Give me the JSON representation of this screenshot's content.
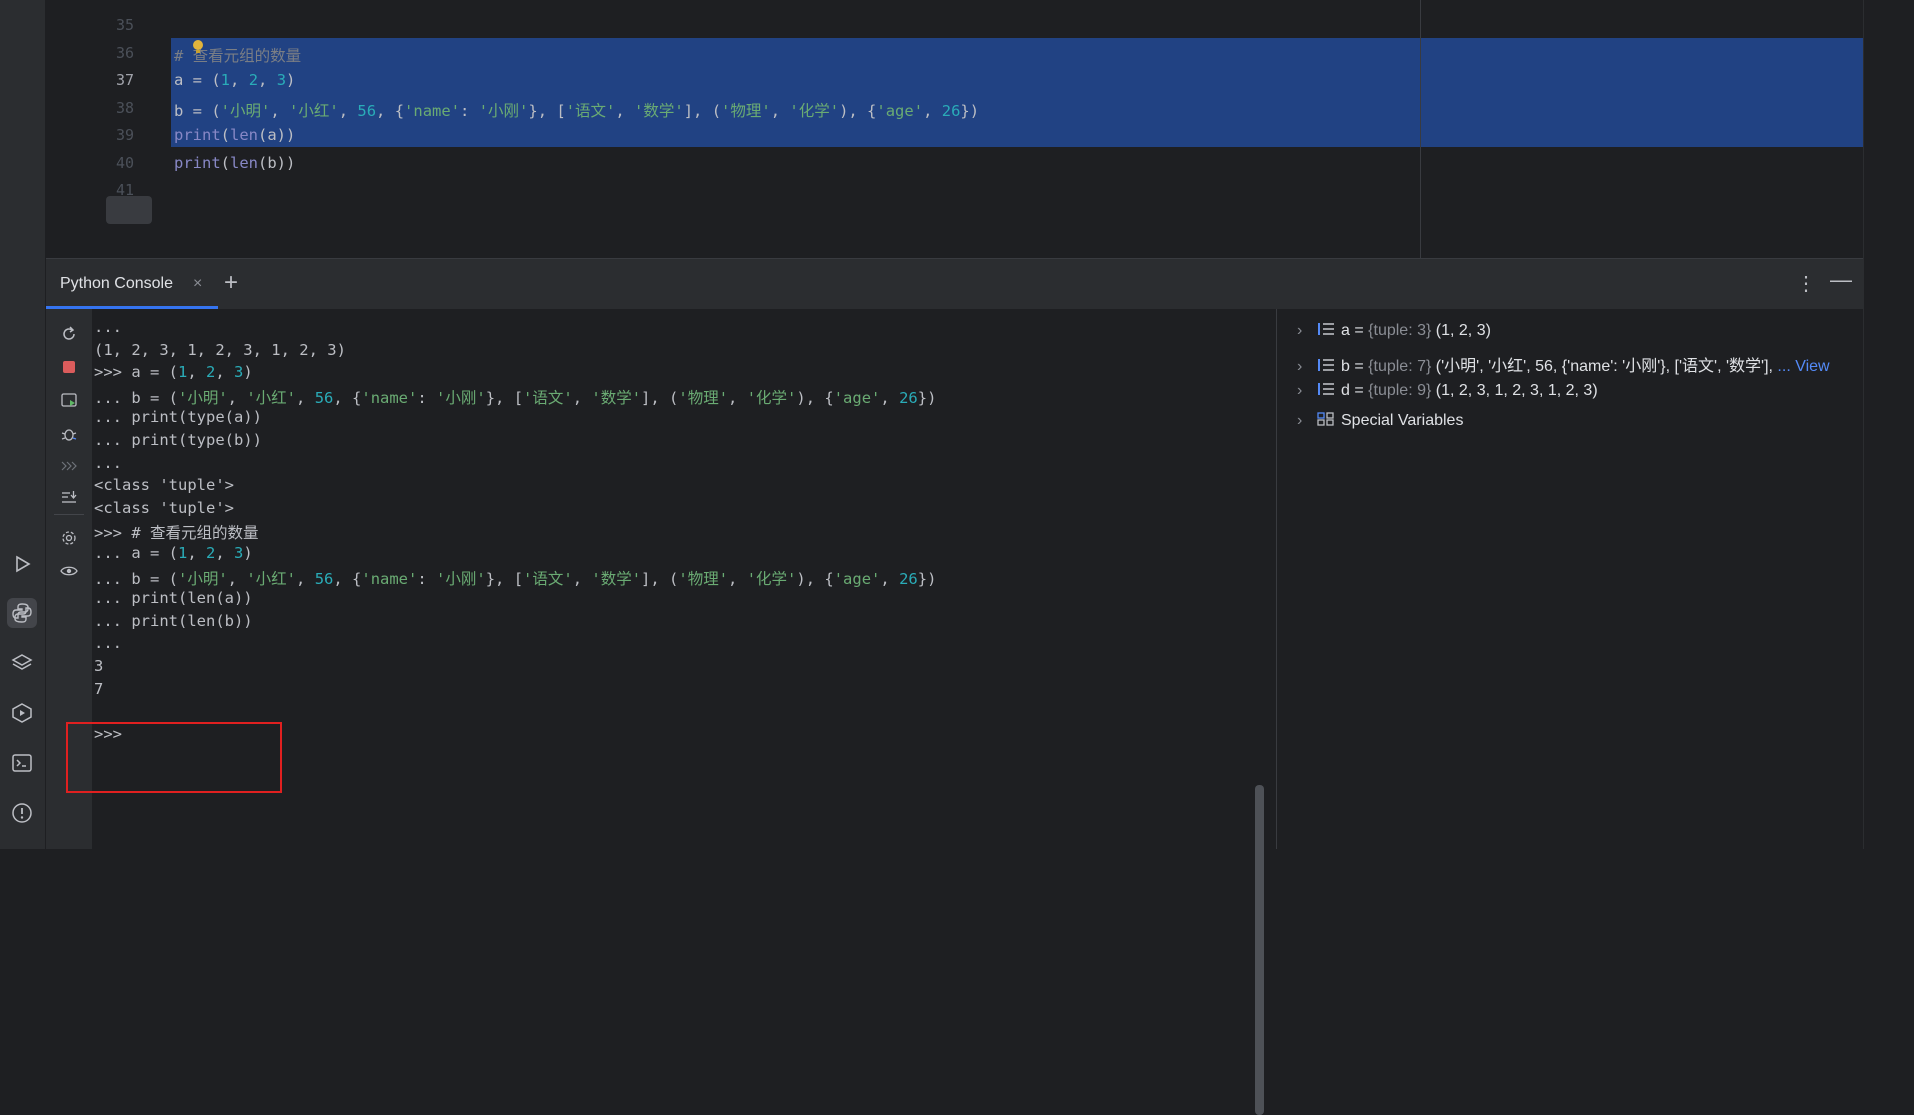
{
  "editor": {
    "line_numbers": [
      "35",
      "36",
      "37",
      "38",
      "39",
      "40",
      "41"
    ],
    "current_line": "37",
    "lines": [
      {
        "n": "35",
        "tokens": []
      },
      {
        "n": "36",
        "tokens": [
          {
            "t": "# 查看元组的数量",
            "c": "cm"
          }
        ]
      },
      {
        "n": "37",
        "tokens": [
          {
            "t": "a = (",
            "c": "kw"
          },
          {
            "t": "1",
            "c": "num"
          },
          {
            "t": ", ",
            "c": "kw"
          },
          {
            "t": "2",
            "c": "num"
          },
          {
            "t": ", ",
            "c": "kw"
          },
          {
            "t": "3",
            "c": "num"
          },
          {
            "t": ")",
            "c": "kw"
          }
        ]
      },
      {
        "n": "38",
        "tokens": [
          {
            "t": "b = (",
            "c": "kw"
          },
          {
            "t": "'小明'",
            "c": "str"
          },
          {
            "t": ", ",
            "c": "kw"
          },
          {
            "t": "'小红'",
            "c": "str"
          },
          {
            "t": ", ",
            "c": "kw"
          },
          {
            "t": "56",
            "c": "num"
          },
          {
            "t": ", {",
            "c": "kw"
          },
          {
            "t": "'name'",
            "c": "str"
          },
          {
            "t": ": ",
            "c": "kw"
          },
          {
            "t": "'小刚'",
            "c": "str"
          },
          {
            "t": "}, [",
            "c": "kw"
          },
          {
            "t": "'语文'",
            "c": "str"
          },
          {
            "t": ", ",
            "c": "kw"
          },
          {
            "t": "'数学'",
            "c": "str"
          },
          {
            "t": "], (",
            "c": "kw"
          },
          {
            "t": "'物理'",
            "c": "str"
          },
          {
            "t": ", ",
            "c": "kw"
          },
          {
            "t": "'化学'",
            "c": "str"
          },
          {
            "t": "), {",
            "c": "kw"
          },
          {
            "t": "'age'",
            "c": "str"
          },
          {
            "t": ", ",
            "c": "kw"
          },
          {
            "t": "26",
            "c": "num"
          },
          {
            "t": "})",
            "c": "kw"
          }
        ]
      },
      {
        "n": "39",
        "tokens": [
          {
            "t": "print",
            "c": "fn"
          },
          {
            "t": "(",
            "c": "kw"
          },
          {
            "t": "len",
            "c": "fn"
          },
          {
            "t": "(a))",
            "c": "kw"
          }
        ]
      },
      {
        "n": "40",
        "tokens": [
          {
            "t": "print",
            "c": "fn"
          },
          {
            "t": "(",
            "c": "kw"
          },
          {
            "t": "len",
            "c": "fn"
          },
          {
            "t": "(b))",
            "c": "kw"
          }
        ]
      },
      {
        "n": "41",
        "tokens": []
      }
    ]
  },
  "tool_window": {
    "tab_label": "Python Console",
    "close_glyph": "×",
    "add_glyph": "+",
    "menu_glyph": "⋮",
    "minimize_glyph": "—"
  },
  "console": {
    "lines": [
      {
        "tokens": [
          {
            "t": "...",
            "c": "kw"
          }
        ]
      },
      {
        "tokens": [
          {
            "t": "(1, 2, 3, 1, 2, 3, 1, 2, 3)",
            "c": "kw"
          }
        ]
      },
      {
        "tokens": [
          {
            "t": ">>> a = (",
            "c": "kw"
          },
          {
            "t": "1",
            "c": "num"
          },
          {
            "t": ", ",
            "c": "kw"
          },
          {
            "t": "2",
            "c": "num"
          },
          {
            "t": ", ",
            "c": "kw"
          },
          {
            "t": "3",
            "c": "num"
          },
          {
            "t": ")",
            "c": "kw"
          }
        ]
      },
      {
        "tokens": [
          {
            "t": "... b = (",
            "c": "kw"
          },
          {
            "t": "'小明'",
            "c": "str"
          },
          {
            "t": ", ",
            "c": "kw"
          },
          {
            "t": "'小红'",
            "c": "str"
          },
          {
            "t": ", ",
            "c": "kw"
          },
          {
            "t": "56",
            "c": "num"
          },
          {
            "t": ", {",
            "c": "kw"
          },
          {
            "t": "'name'",
            "c": "str"
          },
          {
            "t": ": ",
            "c": "kw"
          },
          {
            "t": "'小刚'",
            "c": "str"
          },
          {
            "t": "}, [",
            "c": "kw"
          },
          {
            "t": "'语文'",
            "c": "str"
          },
          {
            "t": ", ",
            "c": "kw"
          },
          {
            "t": "'数学'",
            "c": "str"
          },
          {
            "t": "], (",
            "c": "kw"
          },
          {
            "t": "'物理'",
            "c": "str"
          },
          {
            "t": ", ",
            "c": "kw"
          },
          {
            "t": "'化学'",
            "c": "str"
          },
          {
            "t": "), {",
            "c": "kw"
          },
          {
            "t": "'age'",
            "c": "str"
          },
          {
            "t": ", ",
            "c": "kw"
          },
          {
            "t": "26",
            "c": "num"
          },
          {
            "t": "})",
            "c": "kw"
          }
        ]
      },
      {
        "tokens": [
          {
            "t": "... print(type(a))",
            "c": "kw"
          }
        ]
      },
      {
        "tokens": [
          {
            "t": "... print(type(b))",
            "c": "kw"
          }
        ]
      },
      {
        "tokens": [
          {
            "t": "...",
            "c": "kw"
          }
        ]
      },
      {
        "tokens": [
          {
            "t": "<class 'tuple'>",
            "c": "kw"
          }
        ]
      },
      {
        "tokens": [
          {
            "t": "<class 'tuple'>",
            "c": "kw"
          }
        ]
      },
      {
        "tokens": [
          {
            "t": ">>> # 查看元组的数量",
            "c": "kw"
          }
        ]
      },
      {
        "tokens": [
          {
            "t": "... a = (",
            "c": "kw"
          },
          {
            "t": "1",
            "c": "num"
          },
          {
            "t": ", ",
            "c": "kw"
          },
          {
            "t": "2",
            "c": "num"
          },
          {
            "t": ", ",
            "c": "kw"
          },
          {
            "t": "3",
            "c": "num"
          },
          {
            "t": ")",
            "c": "kw"
          }
        ]
      },
      {
        "tokens": [
          {
            "t": "... b = (",
            "c": "kw"
          },
          {
            "t": "'小明'",
            "c": "str"
          },
          {
            "t": ", ",
            "c": "kw"
          },
          {
            "t": "'小红'",
            "c": "str"
          },
          {
            "t": ", ",
            "c": "kw"
          },
          {
            "t": "56",
            "c": "num"
          },
          {
            "t": ", {",
            "c": "kw"
          },
          {
            "t": "'name'",
            "c": "str"
          },
          {
            "t": ": ",
            "c": "kw"
          },
          {
            "t": "'小刚'",
            "c": "str"
          },
          {
            "t": "}, [",
            "c": "kw"
          },
          {
            "t": "'语文'",
            "c": "str"
          },
          {
            "t": ", ",
            "c": "kw"
          },
          {
            "t": "'数学'",
            "c": "str"
          },
          {
            "t": "], (",
            "c": "kw"
          },
          {
            "t": "'物理'",
            "c": "str"
          },
          {
            "t": ", ",
            "c": "kw"
          },
          {
            "t": "'化学'",
            "c": "str"
          },
          {
            "t": "), {",
            "c": "kw"
          },
          {
            "t": "'age'",
            "c": "str"
          },
          {
            "t": ", ",
            "c": "kw"
          },
          {
            "t": "26",
            "c": "num"
          },
          {
            "t": "})",
            "c": "kw"
          }
        ]
      },
      {
        "tokens": [
          {
            "t": "... print(len(a))",
            "c": "kw"
          }
        ]
      },
      {
        "tokens": [
          {
            "t": "... print(len(b))",
            "c": "kw"
          }
        ]
      },
      {
        "tokens": [
          {
            "t": "...",
            "c": "kw"
          }
        ]
      },
      {
        "tokens": [
          {
            "t": "3",
            "c": "kw"
          }
        ]
      },
      {
        "tokens": [
          {
            "t": "7",
            "c": "kw"
          }
        ]
      },
      {
        "tokens": []
      },
      {
        "tokens": [
          {
            "t": ">>>",
            "c": "kw"
          }
        ]
      }
    ]
  },
  "variables": [
    {
      "name": "a",
      "eq": "=",
      "type": "{tuple: 3}",
      "value": "(1, 2, 3)",
      "view": ""
    },
    {
      "name": "b",
      "eq": "=",
      "type": "{tuple: 7}",
      "value": "('小明', '小红', 56, {'name': '小刚'}, ['语文', '数学'],",
      "view": "... View"
    },
    {
      "name": "d",
      "eq": "=",
      "type": "{tuple: 9}",
      "value": "(1, 2, 3, 1, 2, 3, 1, 2, 3)",
      "view": ""
    }
  ],
  "special_variables_label": "Special Variables",
  "colors": {
    "background": "#1e1f22",
    "panel": "#2b2d30",
    "selection": "#214283",
    "accent": "#3574f0",
    "highlight_box": "#e02020"
  },
  "icons": {
    "left_bar": [
      "run-icon",
      "python-console-icon",
      "layers-icon",
      "services-icon",
      "terminal-icon",
      "problems-icon"
    ],
    "console_tools": [
      "rerun-icon",
      "stop-icon",
      "execute-icon",
      "debug-icon",
      "history-icon",
      "scroll-to-end-icon",
      "settings-icon",
      "show-variables-icon"
    ]
  }
}
